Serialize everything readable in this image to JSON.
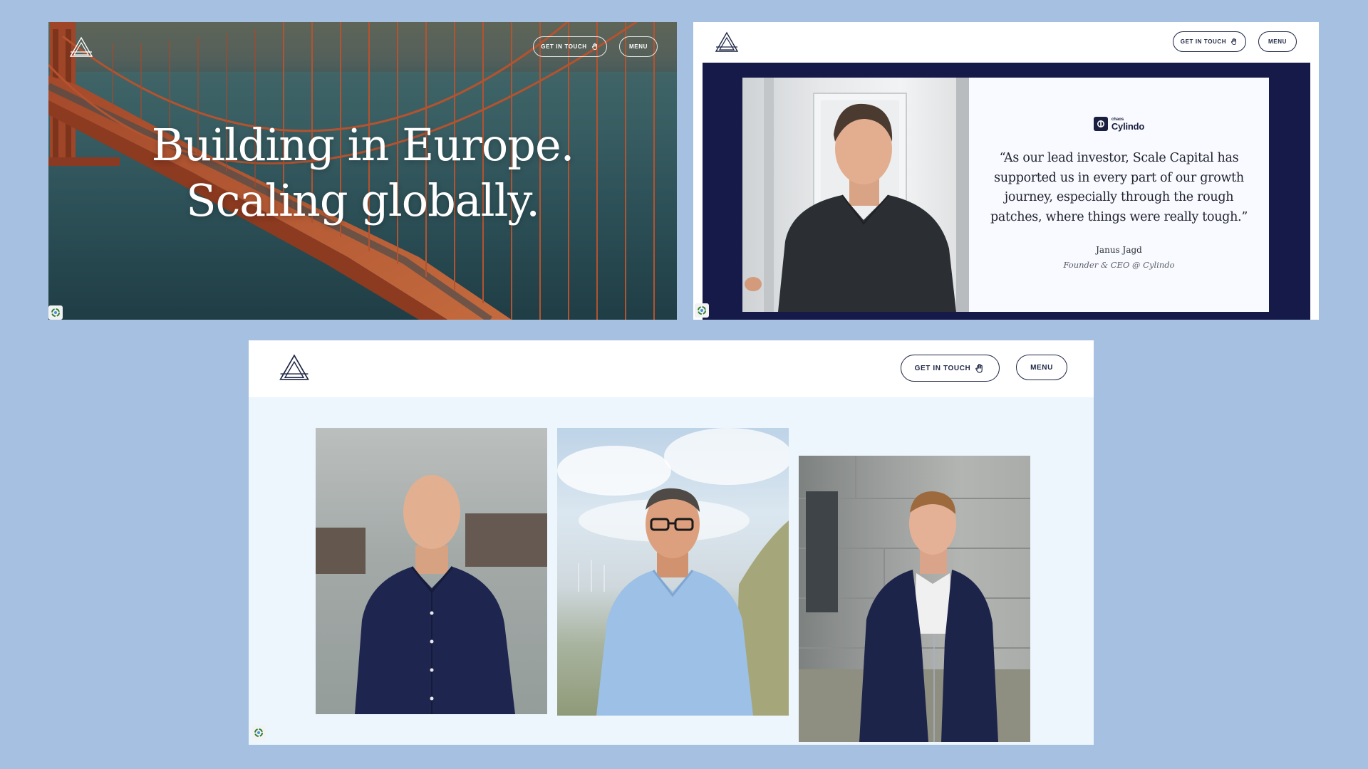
{
  "hero": {
    "headline_line1": "Building in Europe.",
    "headline_line2": "Scaling globally.",
    "get_in_touch_label": "GET IN TOUCH",
    "menu_label": "MENU"
  },
  "testimonial": {
    "get_in_touch_label": "GET IN TOUCH",
    "menu_label": "MENU",
    "brand_small": "chaos",
    "brand_name": "Cylindo",
    "quote": "“As our lead investor, Scale Capital has supported us in every part of our growth journey, especially through the rough patches, where things were really tough.”",
    "author": "Janus Jagd",
    "role": "Founder & CEO @ Cylindo"
  },
  "team": {
    "get_in_touch_label": "GET IN TOUCH",
    "menu_label": "MENU"
  },
  "colors": {
    "page_background": "#a6c0e1",
    "navy": "#161a48",
    "team_background": "#edf6fd",
    "bridge_orange": "#b3532f"
  }
}
